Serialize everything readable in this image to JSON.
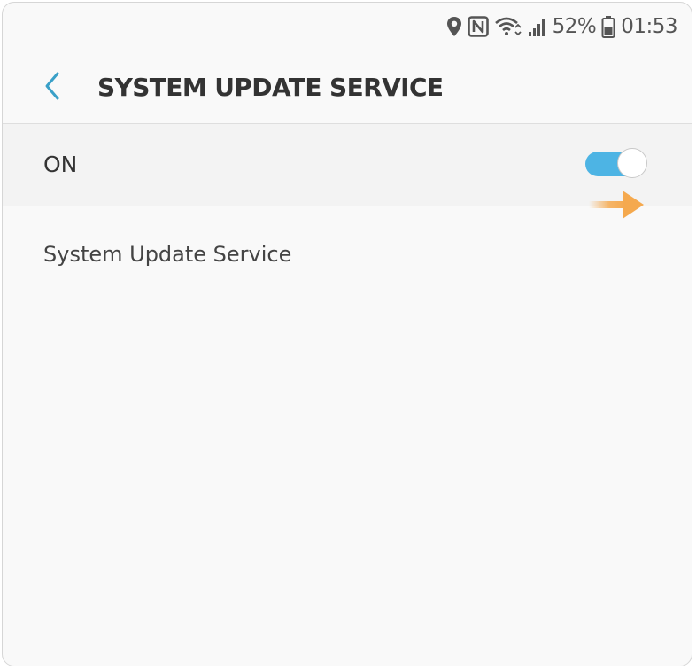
{
  "status_bar": {
    "icons": [
      "location-icon",
      "nfc-icon",
      "wifi-icon",
      "signal-icon",
      "battery-icon"
    ],
    "battery": "52%",
    "time": "01:53"
  },
  "header": {
    "back_icon": "chevron-left-icon",
    "title": "SYSTEM UPDATE SERVICE"
  },
  "master_switch": {
    "label": "ON",
    "enabled": true
  },
  "content": {
    "description": "System Update Service"
  },
  "colors": {
    "accent": "#4db4e4",
    "back_arrow": "#3aa0c8",
    "hint_arrow": "#f5a94e",
    "background": "#f9f9f9",
    "text": "#333333"
  }
}
